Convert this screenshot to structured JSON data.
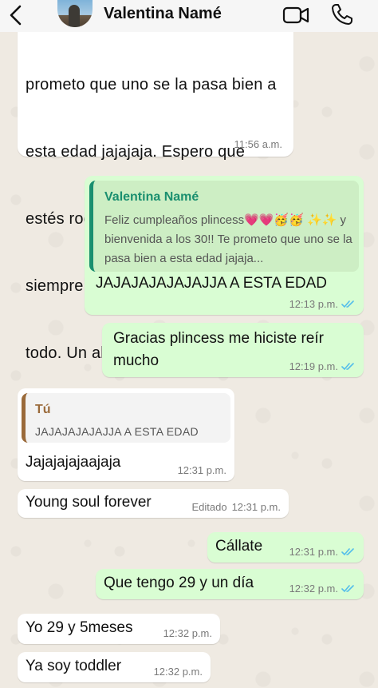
{
  "header": {
    "contact_name": "Valentina Namé",
    "back_icon": "chevron-left-icon",
    "video_icon": "video-call-icon",
    "call_icon": "phone-icon"
  },
  "colors": {
    "incoming_bubble": "#ffffff",
    "outgoing_bubble": "#d9fdd3",
    "read_tick": "#53bdeb",
    "quote_accent_out": "#1a8f6f",
    "quote_accent_in": "#9a6a3a"
  },
  "messages": [
    {
      "direction": "incoming",
      "lines": [
        "prometo que uno se la pasa bien a",
        "esta edad jajajaja. Espero que",
        "estés rodeada de amor y felicidad",
        "siempre y mucha saludo sobre",
        "todo. Un abrazooooo💗💗✨✨"
      ],
      "time": "11:56 a.m."
    },
    {
      "direction": "outgoing",
      "quote_author": "Valentina Namé",
      "quote_text": "Feliz cumpleaños plincess💗💗🥳🥳 ✨✨ y bienvenida a los 30!! Te prometo que uno se la pasa bien a esta edad jajaja...",
      "text": "JAJAJAJAJAJAJJA A ESTA EDAD",
      "time": "12:13 p.m."
    },
    {
      "direction": "outgoing",
      "text": "Gracias plincess me hiciste reír\nmucho",
      "time": "12:19 p.m."
    },
    {
      "direction": "incoming",
      "quote_author": "Tú",
      "quote_text": "JAJAJAJAJAJJA A ESTA EDAD",
      "text": "Jajajajajaajaja",
      "time": "12:31 p.m."
    },
    {
      "direction": "incoming",
      "text": "Young soul forever",
      "edited_label": "Editado",
      "time": "12:31 p.m."
    },
    {
      "direction": "outgoing",
      "text": "Cállate",
      "time": "12:31 p.m."
    },
    {
      "direction": "outgoing",
      "text": "Que tengo 29 y un día",
      "time": "12:32 p.m."
    },
    {
      "direction": "incoming",
      "text": "Yo 29 y 5meses",
      "time": "12:32 p.m."
    },
    {
      "direction": "incoming",
      "text": "Ya soy toddler",
      "time": "12:32 p.m."
    }
  ]
}
